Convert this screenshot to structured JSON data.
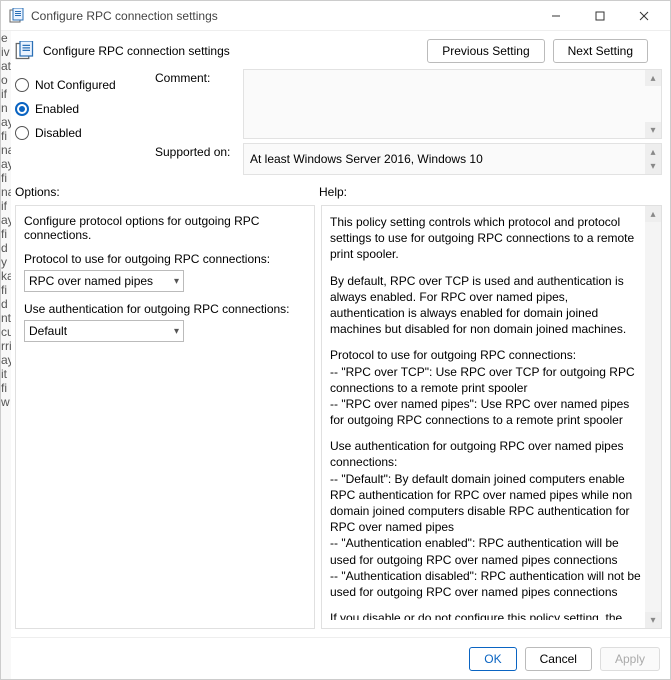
{
  "window": {
    "title": "Configure RPC connection settings"
  },
  "header": {
    "label": "Configure RPC connection settings",
    "prev_btn": "Previous Setting",
    "next_btn": "Next Setting"
  },
  "state": {
    "not_configured_label": "Not Configured",
    "enabled_label": "Enabled",
    "disabled_label": "Disabled",
    "selected": "Enabled"
  },
  "comment": {
    "label": "Comment:",
    "value": ""
  },
  "supported": {
    "label": "Supported on:",
    "value": "At least Windows Server 2016, Windows 10"
  },
  "sections": {
    "options_label": "Options:",
    "help_label": "Help:"
  },
  "options": {
    "intro": "Configure protocol options for outgoing RPC connections.",
    "protocol_label": "Protocol to use for outgoing RPC connections:",
    "protocol_value": "RPC over named pipes",
    "auth_label": "Use authentication for outgoing RPC connections:",
    "auth_value": "Default"
  },
  "help": {
    "p1": "This policy setting controls which protocol and protocol settings to use for outgoing RPC connections to a remote print spooler.",
    "p2": "By default, RPC over TCP is used and authentication is always enabled. For RPC over named pipes, authentication is always enabled for domain joined machines but disabled for non domain joined machines.",
    "p3a": "Protocol to use for outgoing RPC connections:",
    "p3b": "    -- \"RPC over TCP\": Use RPC over TCP for outgoing RPC connections to a remote print spooler",
    "p3c": "    -- \"RPC over named pipes\": Use RPC over named pipes for outgoing RPC connections to a remote print spooler",
    "p4a": "Use authentication for outgoing RPC over named pipes connections:",
    "p4b": "    -- \"Default\": By default domain joined computers enable RPC authentication for RPC over named pipes while non domain joined computers disable RPC authentication for RPC over named pipes",
    "p4c": "    -- \"Authentication enabled\": RPC authentication will be used for outgoing RPC over named pipes connections",
    "p4d": "    -- \"Authentication disabled\": RPC authentication will not be used for outgoing RPC over named pipes connections",
    "p5": "If you disable or do not configure this policy setting, the above defaults will be used."
  },
  "footer": {
    "ok": "OK",
    "cancel": "Cancel",
    "apply": "Apply"
  },
  "slivers": [
    "e",
    "iv",
    "at",
    "o",
    "if",
    "n",
    "ay",
    "fi",
    "na",
    "ay",
    "fi",
    "na",
    "if",
    "ay",
    "fi",
    "d",
    "y",
    "ka",
    "fi",
    "d",
    "nt",
    "cu",
    "rri",
    "ay",
    "it",
    "fi",
    "w"
  ]
}
